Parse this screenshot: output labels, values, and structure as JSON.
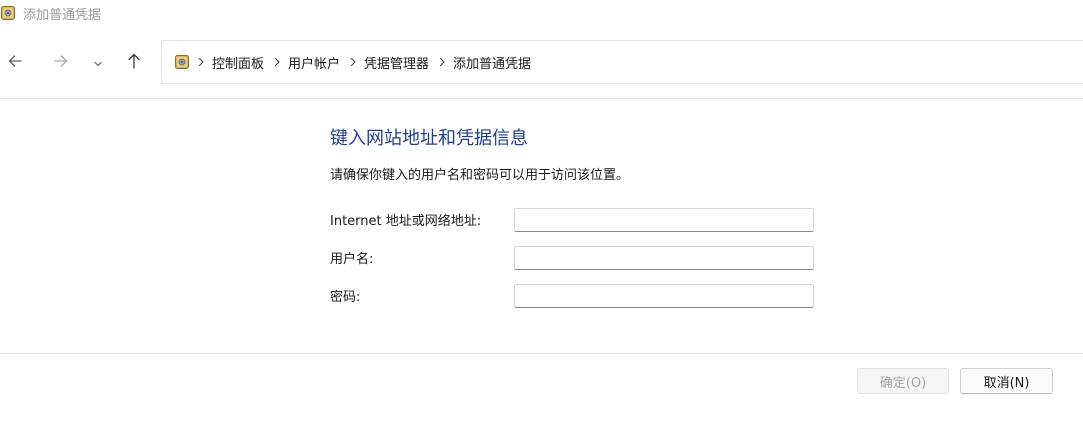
{
  "window": {
    "title": "添加普通凭据",
    "icon": "credential-vault-icon"
  },
  "nav": {
    "back_icon": "arrow-left-icon",
    "forward_icon": "arrow-right-icon",
    "recent_icon": "chevron-down-icon",
    "up_icon": "arrow-up-icon"
  },
  "breadcrumb": {
    "items": [
      {
        "label": "控制面板"
      },
      {
        "label": "用户帐户"
      },
      {
        "label": "凭据管理器"
      },
      {
        "label": "添加普通凭据"
      }
    ]
  },
  "form": {
    "heading": "键入网站地址和凭据信息",
    "description": "请确保你键入的用户名和密码可以用于访问该位置。",
    "fields": [
      {
        "label": "Internet 地址或网络地址:",
        "value": ""
      },
      {
        "label": "用户名:",
        "value": ""
      },
      {
        "label": "密码:",
        "value": ""
      }
    ]
  },
  "buttons": {
    "ok_label": "确定(O)",
    "cancel_label": "取消(N)"
  },
  "colors": {
    "heading": "#1f3f8f",
    "disabled_text": "#a3a3a3"
  }
}
